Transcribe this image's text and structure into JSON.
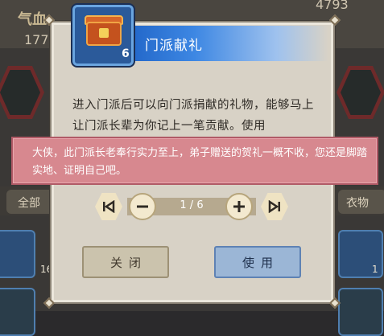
{
  "background": {
    "qixue_label": "气血",
    "qixue_value": "177",
    "xinfa_label": "",
    "top_value": "4793",
    "tab_left": "全部",
    "tab_right": "衣物",
    "slot_count_left": "16",
    "slot_count_right": "1"
  },
  "dialog": {
    "title": "门派献礼",
    "item_icon": "treasure-chest-icon",
    "item_count": "6",
    "description": "进入门派后可以向门派捐献的礼物，能够马上让门派长辈为你记上一笔贡献。使用",
    "toast": "大侠，此门派长老奉行实力至上，弟子赠送的贺礼一概不收，您还是脚踏实地、证明自己吧。",
    "pager": {
      "current": "1",
      "separator": "/",
      "total": "6",
      "first_icon": "first-page-icon",
      "prev_icon": "minus-icon",
      "next_icon": "plus-icon",
      "last_icon": "last-page-icon"
    },
    "close_label": "关闭",
    "use_label": "使用"
  },
  "colors": {
    "title_bar": "#1f63c6",
    "toast_bg": "#d7888f",
    "use_button": "#9bb6d6",
    "close_button": "#cbc3ad"
  }
}
